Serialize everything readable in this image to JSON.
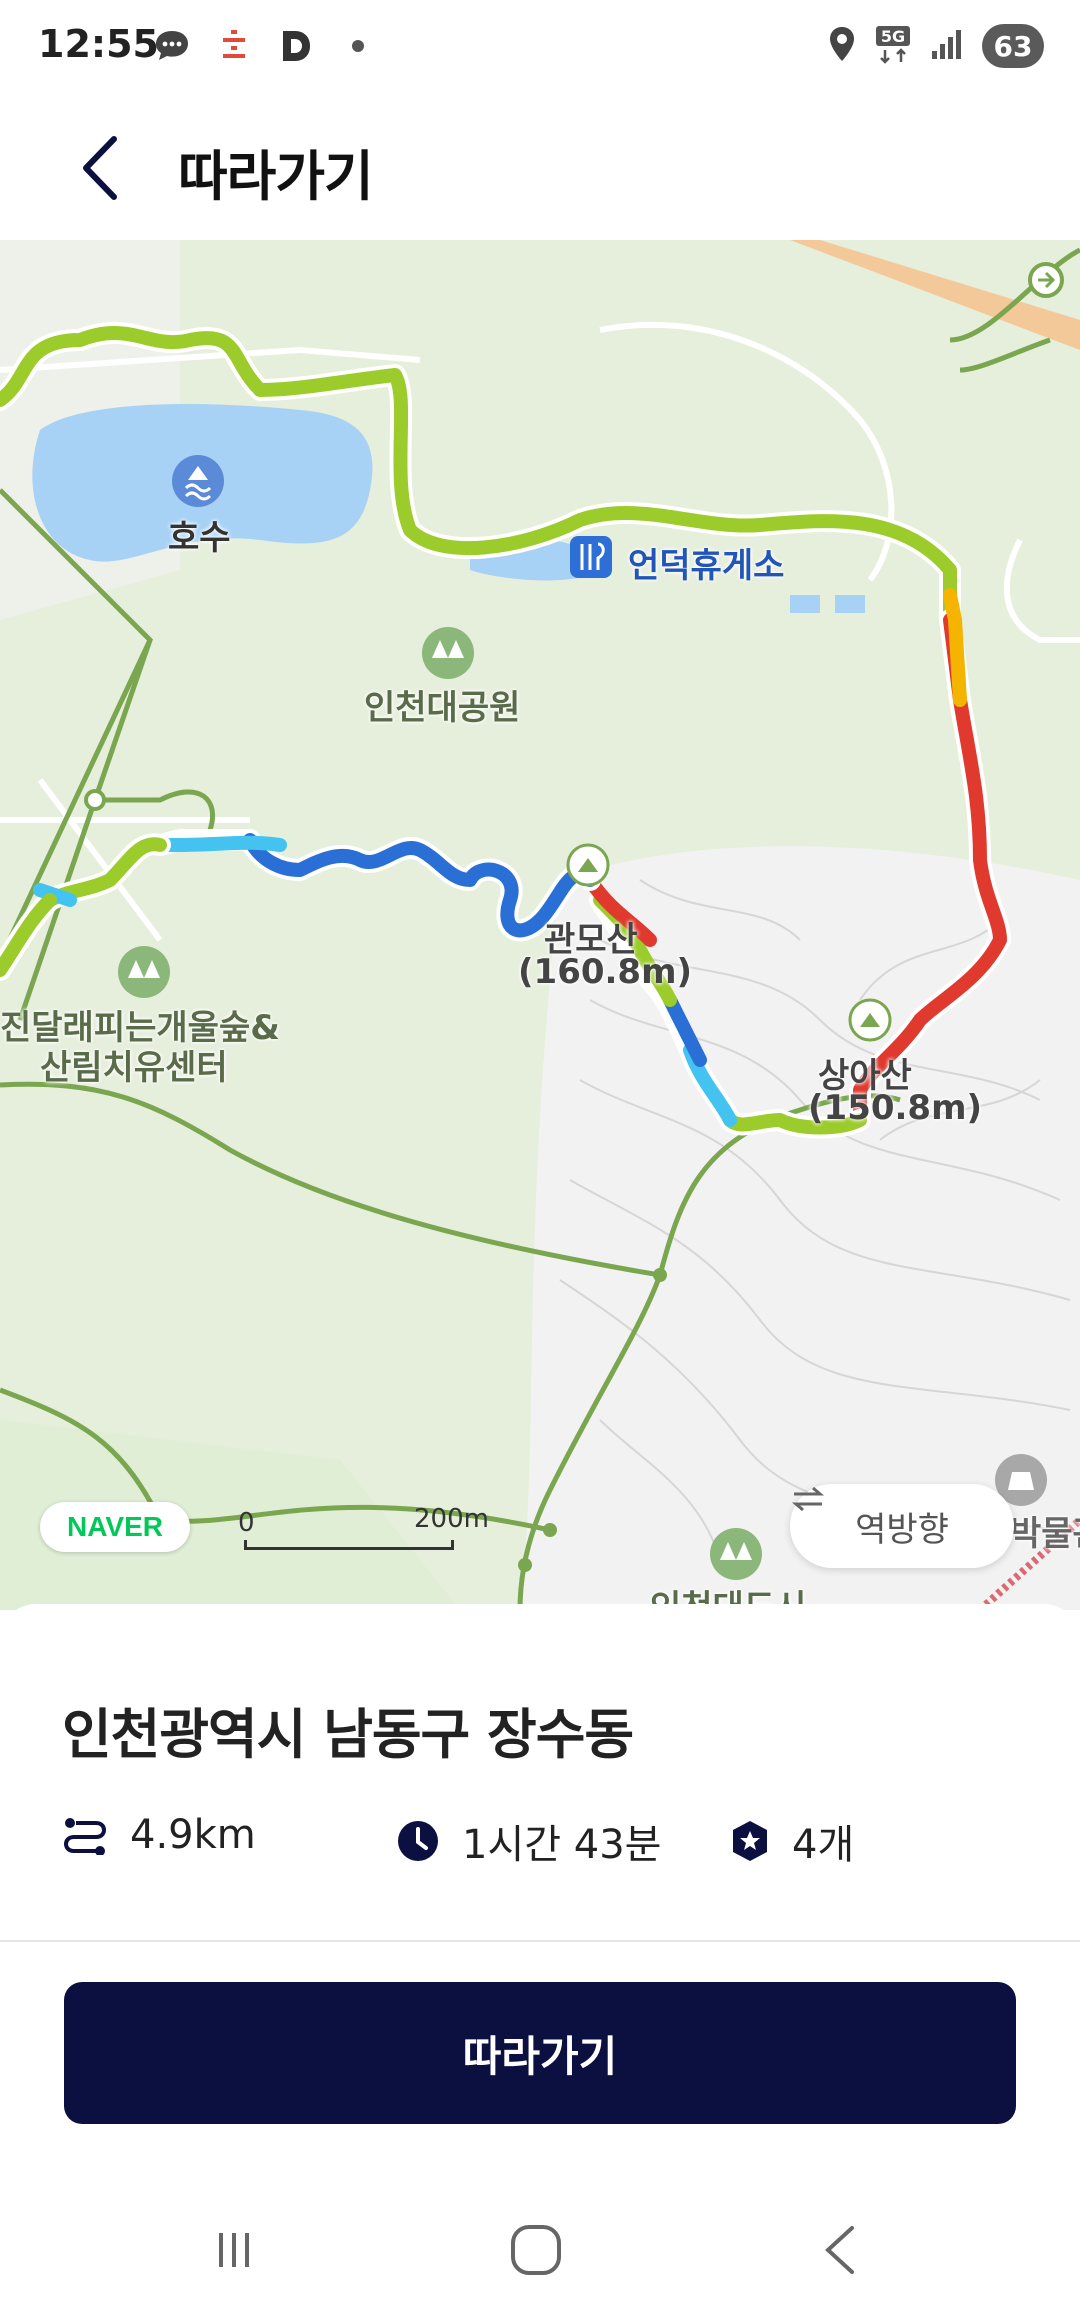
{
  "status_bar": {
    "time": "12:55",
    "battery": "63",
    "network": "5G",
    "icons": [
      "chat-icon",
      "notification-icon",
      "d-app-icon",
      "dot-icon",
      "location-icon",
      "network-5g-icon",
      "signal-icon",
      "battery-icon"
    ]
  },
  "header": {
    "title": "따라가기",
    "back_icon": "back-arrow-icon"
  },
  "map": {
    "labels": {
      "lake": "호수",
      "rest_area": "언덕휴게소",
      "park": "인천대공원",
      "forest_center_line1": "진달래피는개울숲&",
      "forest_center_line2": "산림치유센터",
      "peak1_name": "관모산",
      "peak1_height": "(160.8m)",
      "peak2_name": "상아산",
      "peak2_height": "(150.8m)",
      "museum": "박물관",
      "city_label": "인천대도시"
    },
    "naver_logo": "NAVER",
    "scale_zero": "0",
    "scale_distance": "200m",
    "reverse_button": "역방향",
    "colors": {
      "route_green": "#9ccc2c",
      "route_red": "#e03a2e",
      "route_blue": "#2a6fd6",
      "route_lightblue": "#45c3f0",
      "route_yellow": "#f5b400",
      "park_green": "#dfeccf",
      "water": "#a8d2f5"
    }
  },
  "sheet": {
    "location": "인천광역시 남동구 장수동",
    "distance": "4.9km",
    "duration": "1시간 43분",
    "count": "4개",
    "follow_button": "따라가기"
  },
  "nav_bar": {
    "recent_icon": "recent-apps-icon",
    "home_icon": "home-icon",
    "back_icon": "nav-back-icon"
  }
}
